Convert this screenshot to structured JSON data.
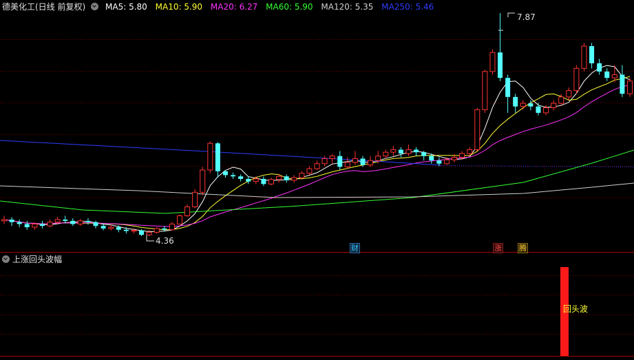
{
  "header": {
    "title": "德美化工(日线 前复权)",
    "ma5": "MA5: 5.80",
    "ma10": "MA10: 5.90",
    "ma20": "MA20: 6.27",
    "ma60": "MA60: 5.90",
    "ma120": "MA120: 5.35",
    "ma250": "MA250: 5.46"
  },
  "annotations": {
    "high": "7.87",
    "low": "4.36"
  },
  "badges": {
    "cai": "财",
    "zhang": "涨",
    "teng": "腾"
  },
  "sub_panel": {
    "title": "上涨回头波幅",
    "bar_label": "回头波"
  },
  "colors": {
    "background": "#000000",
    "up": "#ff3333",
    "down": "#54ffff",
    "grid": "#8a0000",
    "ma5": "#ffffff",
    "ma10": "#ffff33",
    "ma20": "#ff33ff",
    "ma60": "#33ff33",
    "ma120": "#d0d0d0",
    "ma250": "#2e3cff"
  }
}
